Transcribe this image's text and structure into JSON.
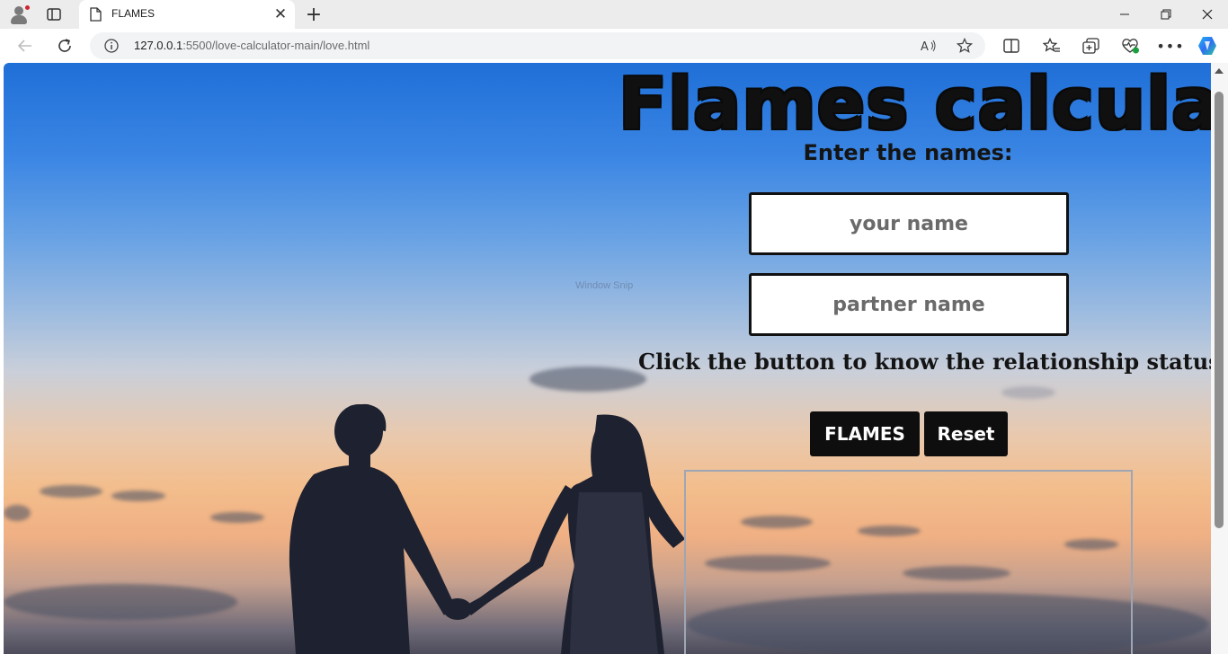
{
  "browser": {
    "tab_title": "FLAMES",
    "url_host": "127.0.0.1",
    "url_rest": ":5500/love-calculator-main/love.html"
  },
  "page": {
    "heading": "Flames calculator",
    "subheading": "Enter the names:",
    "your_name_placeholder": "your name",
    "partner_name_placeholder": "partner name",
    "instruction": "Click the button to know the relationship status:",
    "flames_button": "FLAMES",
    "reset_button": "Reset",
    "watermark": "Window Snip"
  },
  "icons": {
    "profile": "profile-icon",
    "tab_actions": "tab-actions-icon",
    "favicon": "page-icon",
    "back": "back-arrow-icon",
    "reload": "reload-icon",
    "info": "info-icon",
    "read_aloud": "read-aloud-icon",
    "favorite": "star-icon",
    "split_screen": "split-screen-icon",
    "favorites": "favorites-icon",
    "collections": "collections-icon",
    "browser_essentials": "heart-pulse-icon",
    "more": "more-icon",
    "copilot": "copilot-icon"
  }
}
